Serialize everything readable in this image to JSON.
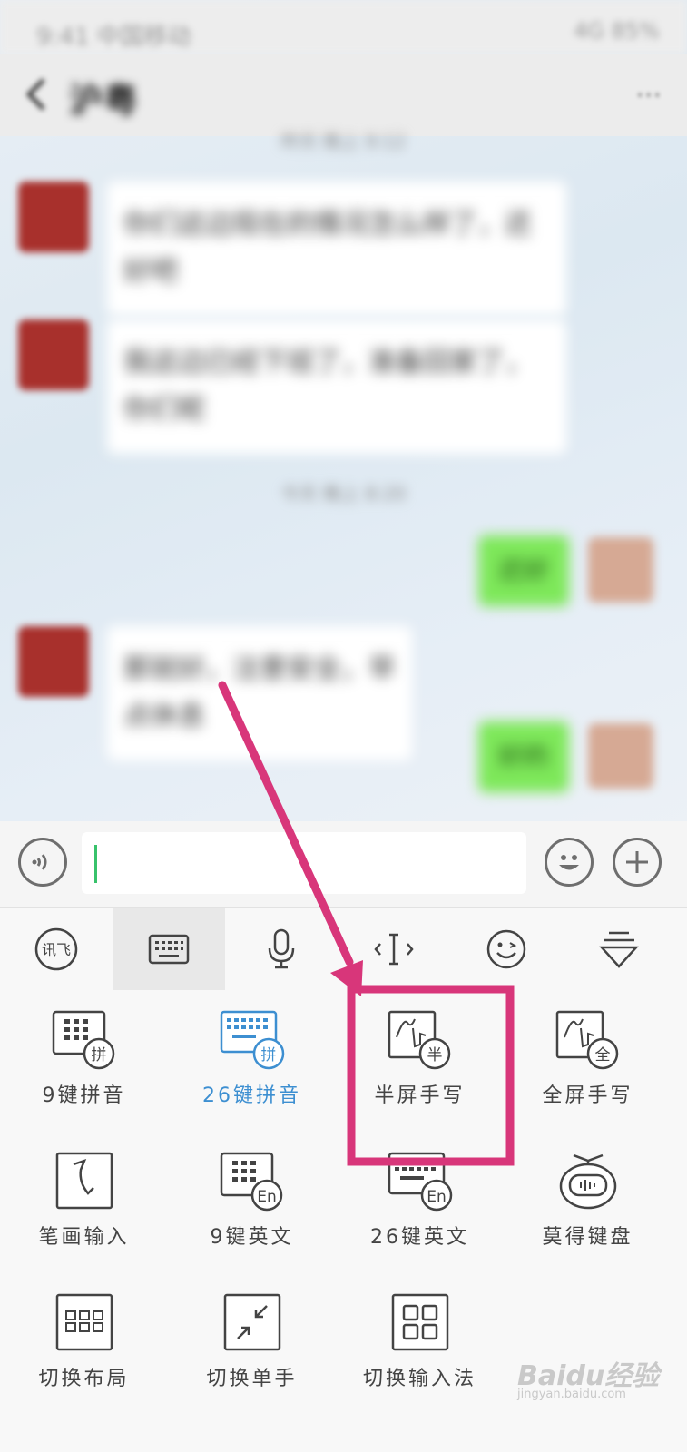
{
  "status_bar": {
    "left": "9:41 中国移动",
    "right": "4G 85%"
  },
  "chat": {
    "title": "沪粤",
    "messages": [
      {
        "type": "time",
        "text": "昨天 晚上 9:12"
      },
      {
        "type": "in",
        "text": "你们这边现在的情况怎么样了，还好吧"
      },
      {
        "type": "in",
        "text": "我这边已经下班了，准备回家了，你们呢"
      },
      {
        "type": "time",
        "text": "今天 晚上 8:20"
      },
      {
        "type": "out",
        "text": "还好"
      },
      {
        "type": "in",
        "text": "那就好，注意安全，早点休息"
      },
      {
        "type": "out",
        "text": "好的"
      }
    ]
  },
  "input_bar": {
    "placeholder": ""
  },
  "ime_toolbar": {
    "items": [
      {
        "name": "xunfei-logo-icon",
        "label": "讯飞"
      },
      {
        "name": "keyboard-icon",
        "label": "键盘"
      },
      {
        "name": "microphone-icon",
        "label": "语音"
      },
      {
        "name": "cursor-icon",
        "label": "光标"
      },
      {
        "name": "emoji-icon",
        "label": "表情"
      },
      {
        "name": "collapse-icon",
        "label": "收起"
      }
    ]
  },
  "ime_modes": [
    {
      "label": "9键拼音",
      "badge": "拼",
      "icon": "nine-key-pinyin-icon",
      "selected": false
    },
    {
      "label": "26键拼音",
      "badge": "拼",
      "icon": "twenty-six-key-pinyin-icon",
      "selected": true
    },
    {
      "label": "半屏手写",
      "badge": "半",
      "icon": "half-screen-handwriting-icon",
      "selected": false
    },
    {
      "label": "全屏手写",
      "badge": "全",
      "icon": "full-screen-handwriting-icon",
      "selected": false
    },
    {
      "label": "笔画输入",
      "icon": "stroke-input-icon",
      "selected": false
    },
    {
      "label": "9键英文",
      "badge": "En",
      "icon": "nine-key-english-icon",
      "selected": false
    },
    {
      "label": "26键英文",
      "badge": "En",
      "icon": "twenty-six-key-english-icon",
      "selected": false
    },
    {
      "label": "莫得键盘",
      "icon": "no-keyboard-robot-icon",
      "selected": false
    },
    {
      "label": "切换布局",
      "icon": "switch-layout-icon",
      "selected": false
    },
    {
      "label": "切换单手",
      "icon": "switch-one-hand-icon",
      "selected": false
    },
    {
      "label": "切换输入法",
      "icon": "switch-input-method-icon",
      "selected": false
    }
  ],
  "annotation": {
    "highlight_color": "#d8367a",
    "target": "半屏手写"
  },
  "watermark": {
    "logo": "Baidu经验",
    "url": "jingyan.baidu.com"
  },
  "colors": {
    "accent_blue": "#3d8fd1",
    "caret_green": "#38c26b",
    "bubble_green": "#7ee85a"
  }
}
